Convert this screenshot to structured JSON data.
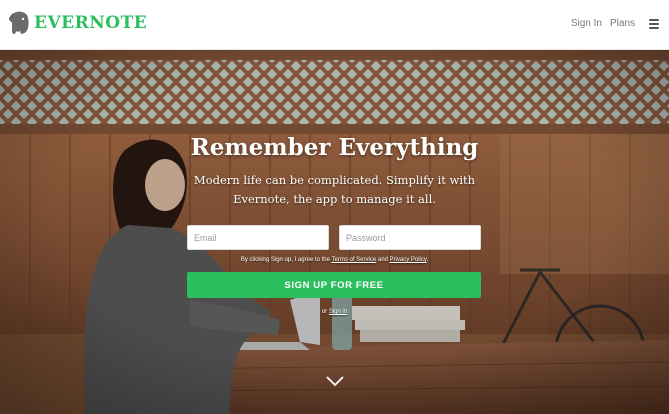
{
  "header": {
    "brand": "EVERNOTE",
    "brand_color": "#2dbe60",
    "logo_icon": "elephant-icon",
    "nav": {
      "sign_in": "Sign In",
      "plans": "Plans",
      "menu_icon": "hamburger-icon"
    }
  },
  "hero": {
    "headline": "Remember Everything",
    "subline": "Modern life can be complicated. Simplify it with Evernote, the app to manage it all.",
    "email": {
      "placeholder": "Email",
      "value": ""
    },
    "password": {
      "placeholder": "Password",
      "value": ""
    },
    "terms": {
      "prefix": "By clicking Sign up, I agree to the",
      "terms_link": "Terms of Service",
      "and": "and",
      "privacy_link": "Privacy Policy",
      "suffix": "."
    },
    "signup_button": "SIGN UP FOR FREE",
    "button_color": "#2dbe60",
    "or_text": "or",
    "signin_link": "Sign in",
    "scroll_icon": "chevron-down-icon"
  }
}
